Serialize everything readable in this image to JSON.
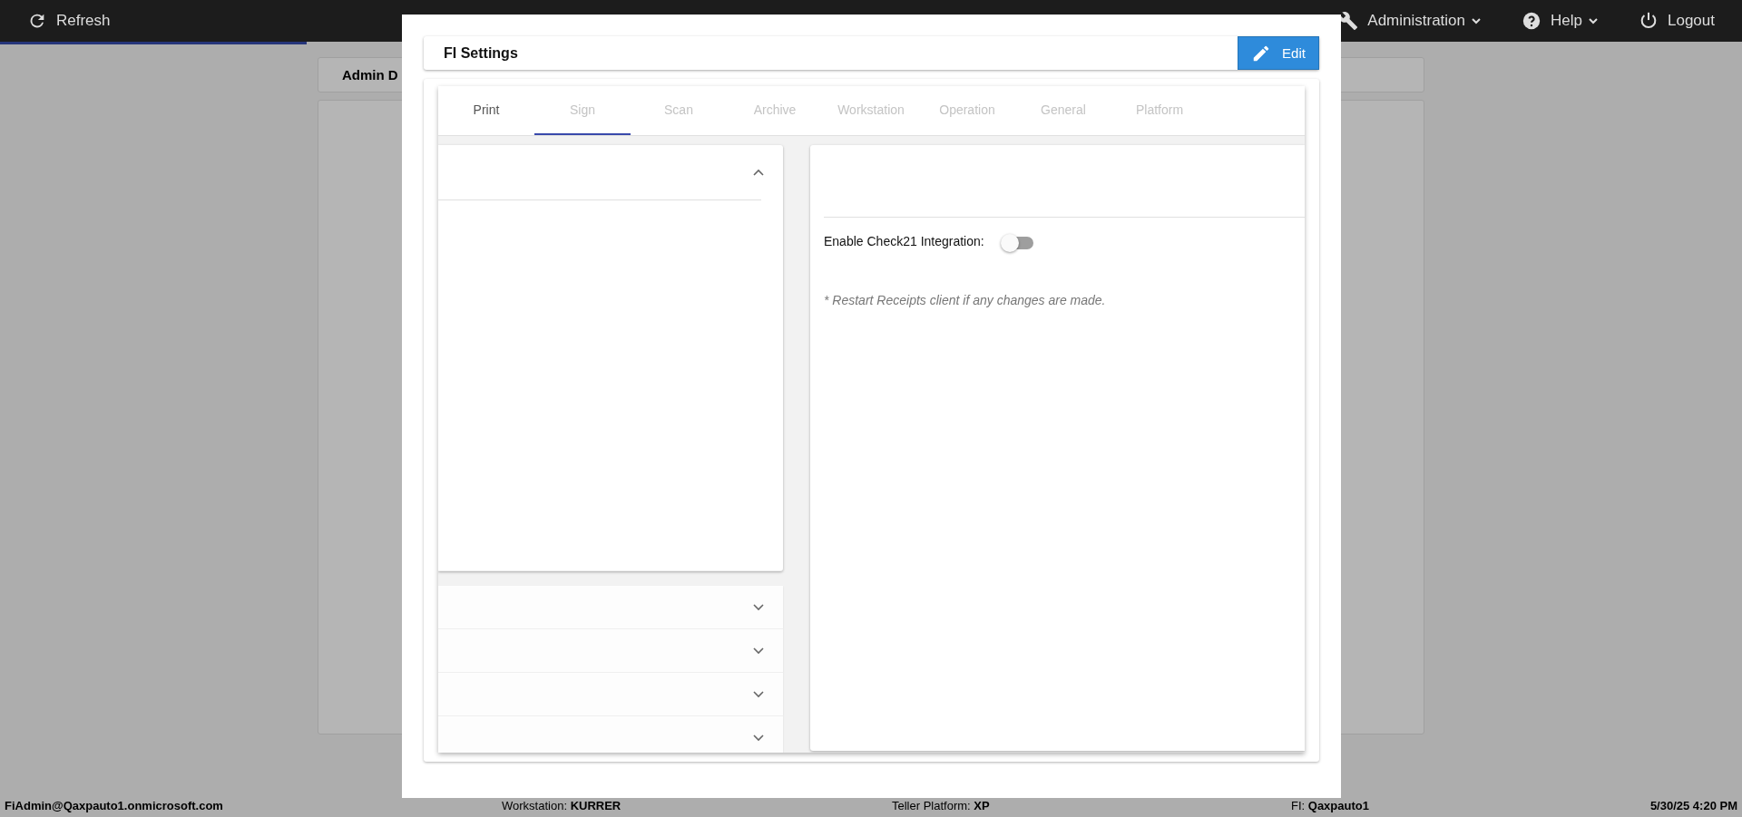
{
  "top_bar": {
    "refresh": "Refresh",
    "menus": [
      {
        "kind": "wrench",
        "label": "Administration",
        "dropdown": true
      },
      {
        "kind": "help",
        "label": "Help",
        "dropdown": true
      },
      {
        "kind": "power",
        "label": "Logout",
        "dropdown": false
      }
    ]
  },
  "admin_panel": {
    "title": "Admin D"
  },
  "modal": {
    "title": "FI Settings",
    "edit_button": "Edit",
    "tabs": [
      {
        "label": "Print",
        "selected": false,
        "disabled": false
      },
      {
        "label": "Sign",
        "selected": true,
        "disabled": true
      },
      {
        "label": "Scan",
        "selected": false,
        "disabled": true
      },
      {
        "label": "Archive",
        "selected": false,
        "disabled": true
      },
      {
        "label": "Workstation",
        "selected": false,
        "disabled": true
      },
      {
        "label": "Operation",
        "selected": false,
        "disabled": true
      },
      {
        "label": "General",
        "selected": false,
        "disabled": true
      },
      {
        "label": "Platform",
        "selected": false,
        "disabled": true
      }
    ],
    "accordion": [
      {
        "expanded": true
      },
      {
        "expanded": false
      },
      {
        "expanded": false
      },
      {
        "expanded": false
      },
      {
        "expanded": false
      }
    ],
    "settings": {
      "label": "Enable Check21 Integration:",
      "on": false,
      "note": "* Restart Receipts client if any changes are made."
    }
  },
  "status_bar": {
    "user": "FiAdmin@Qaxpauto1.onmicrosoft.com",
    "workstation": "Workstation: **KURRER**",
    "platform": "Teller Platform: **XP**",
    "fi": "FI: **Qaxpauto1**",
    "datetime": "5/30/25 4:20 PM"
  }
}
